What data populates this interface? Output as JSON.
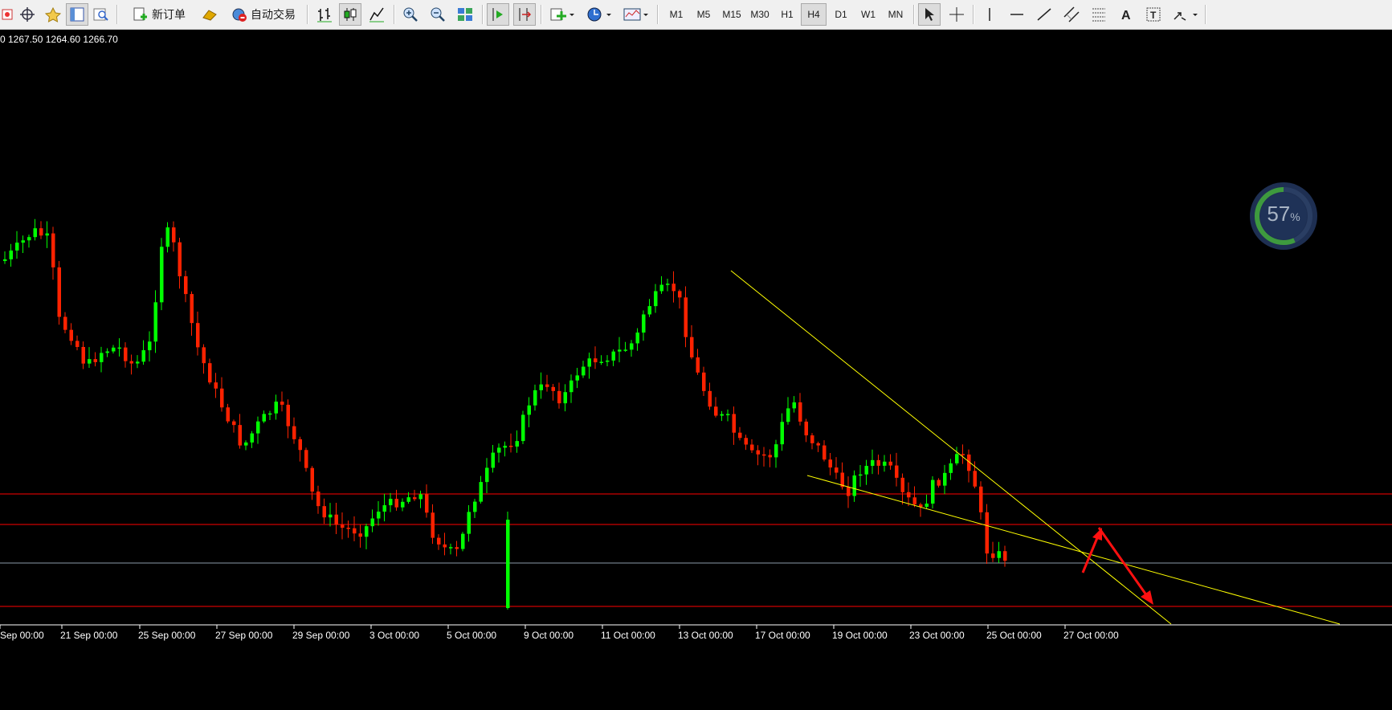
{
  "toolbar": {
    "new_order_label": "新订单",
    "auto_trade_label": "自动交易",
    "timeframes": [
      "M1",
      "M5",
      "M15",
      "M30",
      "H1",
      "H4",
      "D1",
      "W1",
      "MN"
    ],
    "active_timeframe": "H4"
  },
  "chart": {
    "ohlc_text": "0 1267.50 1264.60 1266.70",
    "x_ticks": [
      "Sep 00:00",
      "21 Sep 00:00",
      "25 Sep 00:00",
      "27 Sep 00:00",
      "29 Sep 00:00",
      "3 Oct 00:00",
      "5 Oct 00:00",
      "9 Oct 00:00",
      "11 Oct 00:00",
      "13 Oct 00:00",
      "17 Oct 00:00",
      "19 Oct 00:00",
      "23 Oct 00:00",
      "25 Oct 00:00",
      "27 Oct 00:00"
    ],
    "bull_color": "#00ff00",
    "bear_color": "#ff2200",
    "bg_color": "#000000",
    "trendline_color": "#ffff00",
    "hline_color": "#ff0000"
  },
  "progress_widget": {
    "value": "57",
    "unit": "%"
  },
  "colors": {
    "toolbar_bg": "#f0f0f0",
    "chart_bg": "#000000",
    "accent_gauge": "#2a3f66",
    "gauge_arc": "#3a9a3a"
  }
}
